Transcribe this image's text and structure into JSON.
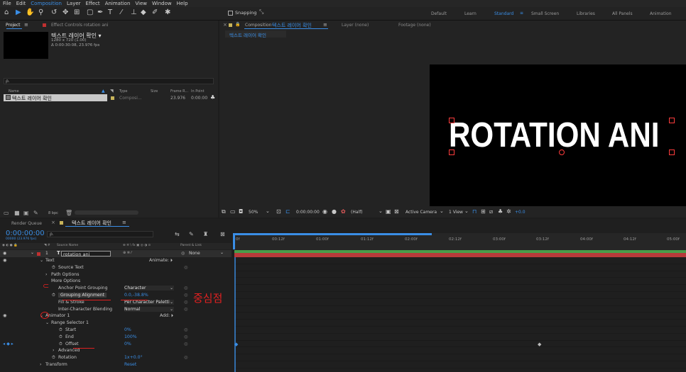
{
  "menu": [
    "File",
    "Edit",
    "Composition",
    "Layer",
    "Effect",
    "Animation",
    "View",
    "Window",
    "Help"
  ],
  "workspace": {
    "snapping": "Snapping",
    "items": [
      "Default",
      "Learn",
      "Standard",
      "Small Screen",
      "Libraries",
      "All Panels",
      "Animation"
    ],
    "active": "Standard"
  },
  "project": {
    "tab": "Project",
    "effect_controls": "Effect Controls rotation ani",
    "comp_name": "텍스트 레이어 확인 ▾",
    "comp_res": "1280 x 720 (1.00)",
    "comp_dur": "Δ 0:00:30:08, 23.976 fps",
    "search_placeholder": "ρ.",
    "cols": [
      "Name",
      "Type",
      "Size",
      "Frame R...",
      "In Point"
    ],
    "item_name": "텍스트 레이어 확인",
    "item_type": "Composi...",
    "item_fps": "23.976",
    "item_in": "0:00:00",
    "bpc": "8 bpc"
  },
  "viewer": {
    "tab_prefix": "Composition",
    "tab_name": "텍스트 레이어 확인",
    "layer": "Layer (none)",
    "footage": "Footage (none)",
    "sub_tab": "텍스트 레이어 확인",
    "canvas_text": "ROTATION ANI",
    "zoom": "50%",
    "time": "0:00:00:00",
    "quality": "(Half)",
    "camera": "Active Camera",
    "view": "1 View",
    "exposure": "+0.0"
  },
  "timeline": {
    "render_queue": "Render Queue",
    "comp_tab": "텍스트 레이어 확인",
    "timecode": "0:00:00:00",
    "timecode_sub": "00000 (23.976 fps)",
    "search_placeholder": "ρ.",
    "col_source": "Source Name",
    "col_parent": "Parent & Link",
    "layer_num": "1",
    "layer_name": "rotation ani",
    "parent_val": "None",
    "ticks": [
      "0f",
      "00:12f",
      "01:00f",
      "01:12f",
      "02:00f",
      "02:12f",
      "03:00f",
      "03:12f",
      "04:00f",
      "04:12f",
      "05:00f"
    ],
    "rows": [
      {
        "label": "Text",
        "indent": 1,
        "extra": "Animate:"
      },
      {
        "label": "Source Text",
        "indent": 3
      },
      {
        "label": "Path Options",
        "indent": 2
      },
      {
        "label": "More Options",
        "indent": 2
      },
      {
        "label": "Anchor Point Grouping",
        "indent": 3,
        "value": "Character",
        "dropdown": true
      },
      {
        "label": "Grouping Alignment",
        "indent": 3,
        "value": "0.0,-38.8%",
        "blue": true
      },
      {
        "label": "Fill & Stroke",
        "indent": 3,
        "value": "Per Character Paletti",
        "dropdown": true
      },
      {
        "label": "Inter-Character Blending",
        "indent": 3,
        "value": "Normal",
        "dropdown": true
      },
      {
        "label": "Animator 1",
        "indent": 1,
        "extra": "Add:"
      },
      {
        "label": "Range Selector 1",
        "indent": 2
      },
      {
        "label": "Start",
        "indent": 4,
        "value": "0%",
        "blue": true
      },
      {
        "label": "End",
        "indent": 4,
        "value": "100%",
        "blue": true
      },
      {
        "label": "Offset",
        "indent": 4,
        "value": "0%",
        "blue": true
      },
      {
        "label": "Advanced",
        "indent": 3
      },
      {
        "label": "Rotation",
        "indent": 3,
        "value": "1x+0.0°",
        "blue": true
      },
      {
        "label": "Transform",
        "indent": 1,
        "value": "Reset",
        "blue": true
      }
    ],
    "annotation": "중심점"
  },
  "colors": {
    "accent": "#3a8ee6",
    "annotation": "#e02020",
    "layer_bar": "#b83a3a"
  }
}
